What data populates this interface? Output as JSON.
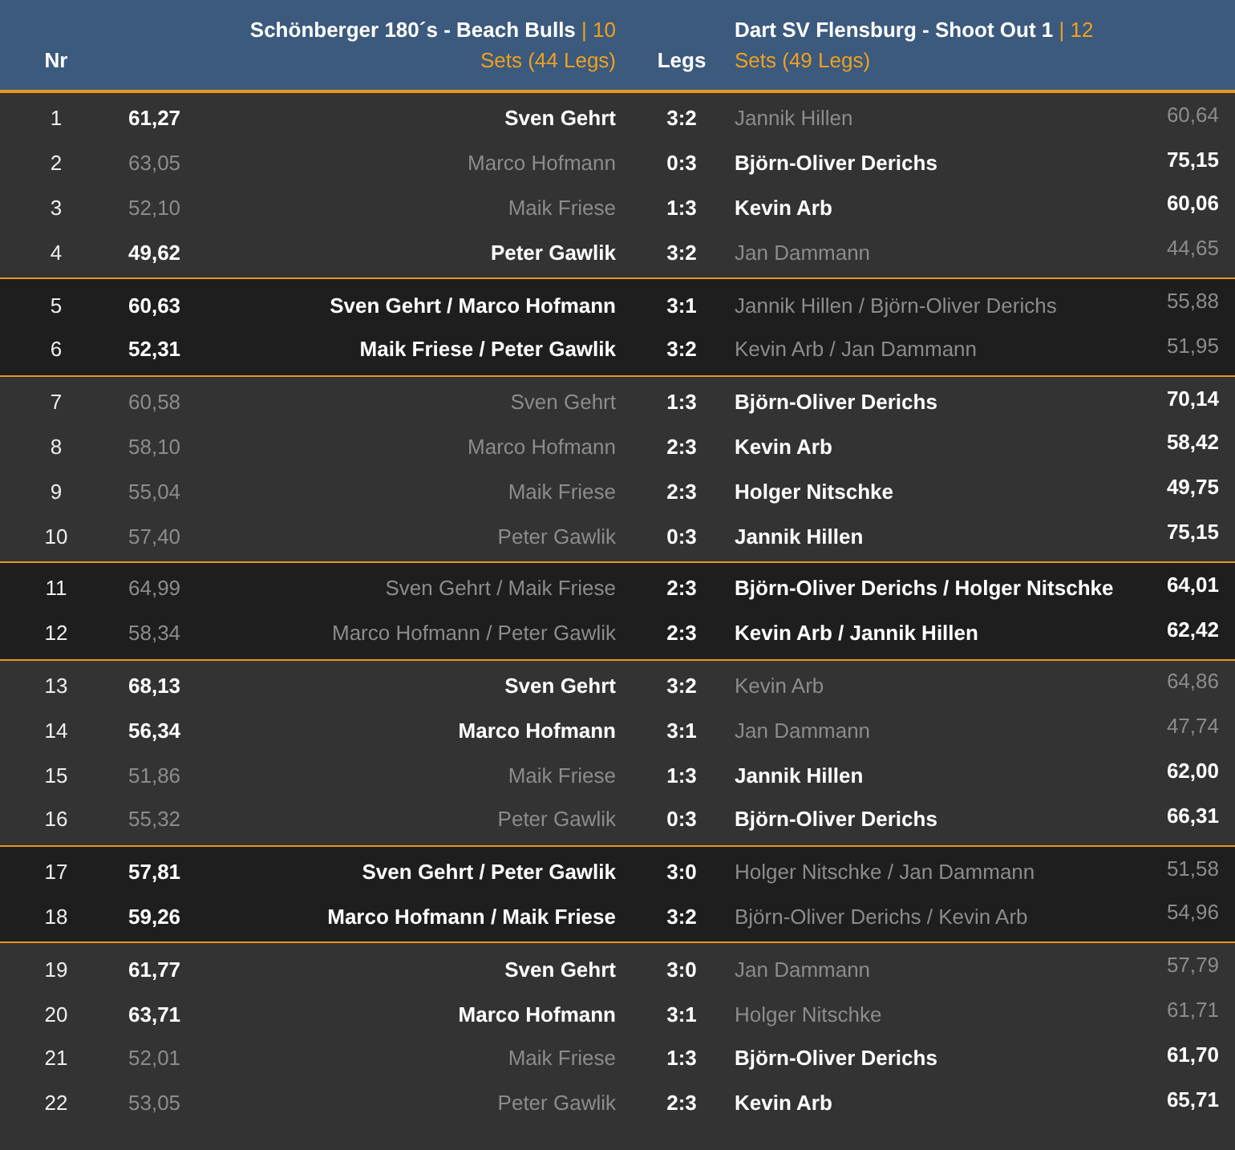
{
  "header": {
    "nr": "Nr",
    "legs": "Legs",
    "home_team": {
      "name": "Schönberger 180´s - Beach Bulls",
      "score": "| 10",
      "summary": "Sets (44 Legs)"
    },
    "away_team": {
      "name": "Dart SV Flensburg - Shoot Out 1",
      "score": "| 12",
      "summary": "Sets (49 Legs)"
    }
  },
  "groups": [
    {
      "kind": "singles",
      "rows": [
        {
          "nr": "1",
          "home_avg": "61,27",
          "home": "Sven Gehrt",
          "legs": "3:2",
          "away": "Jannik Hillen",
          "away_avg": "60,64",
          "home_won": true
        },
        {
          "nr": "2",
          "home_avg": "63,05",
          "home": "Marco Hofmann",
          "legs": "0:3",
          "away": "Björn-Oliver Derichs",
          "away_avg": "75,15",
          "home_won": false
        },
        {
          "nr": "3",
          "home_avg": "52,10",
          "home": "Maik Friese",
          "legs": "1:3",
          "away": "Kevin Arb",
          "away_avg": "60,06",
          "home_won": false
        },
        {
          "nr": "4",
          "home_avg": "49,62",
          "home": "Peter Gawlik",
          "legs": "3:2",
          "away": "Jan Dammann",
          "away_avg": "44,65",
          "home_won": true
        }
      ]
    },
    {
      "kind": "doubles",
      "rows": [
        {
          "nr": "5",
          "home_avg": "60,63",
          "home": "Sven Gehrt / Marco Hofmann",
          "legs": "3:1",
          "away": "Jannik Hillen / Björn-Oliver Derichs",
          "away_avg": "55,88",
          "home_won": true
        },
        {
          "nr": "6",
          "home_avg": "52,31",
          "home": "Maik Friese / Peter Gawlik",
          "legs": "3:2",
          "away": "Kevin Arb / Jan Dammann",
          "away_avg": "51,95",
          "home_won": true
        }
      ]
    },
    {
      "kind": "singles",
      "rows": [
        {
          "nr": "7",
          "home_avg": "60,58",
          "home": "Sven Gehrt",
          "legs": "1:3",
          "away": "Björn-Oliver Derichs",
          "away_avg": "70,14",
          "home_won": false
        },
        {
          "nr": "8",
          "home_avg": "58,10",
          "home": "Marco Hofmann",
          "legs": "2:3",
          "away": "Kevin Arb",
          "away_avg": "58,42",
          "home_won": false
        },
        {
          "nr": "9",
          "home_avg": "55,04",
          "home": "Maik Friese",
          "legs": "2:3",
          "away": "Holger Nitschke",
          "away_avg": "49,75",
          "home_won": false
        },
        {
          "nr": "10",
          "home_avg": "57,40",
          "home": "Peter Gawlik",
          "legs": "0:3",
          "away": "Jannik Hillen",
          "away_avg": "75,15",
          "home_won": false
        }
      ]
    },
    {
      "kind": "doubles",
      "rows": [
        {
          "nr": "11",
          "home_avg": "64,99",
          "home": "Sven Gehrt / Maik Friese",
          "legs": "2:3",
          "away": "Björn-Oliver Derichs / Holger Nitschke",
          "away_avg": "64,01",
          "home_won": false
        },
        {
          "nr": "12",
          "home_avg": "58,34",
          "home": "Marco Hofmann / Peter Gawlik",
          "legs": "2:3",
          "away": "Kevin Arb / Jannik Hillen",
          "away_avg": "62,42",
          "home_won": false
        }
      ]
    },
    {
      "kind": "singles",
      "rows": [
        {
          "nr": "13",
          "home_avg": "68,13",
          "home": "Sven Gehrt",
          "legs": "3:2",
          "away": "Kevin Arb",
          "away_avg": "64,86",
          "home_won": true
        },
        {
          "nr": "14",
          "home_avg": "56,34",
          "home": "Marco Hofmann",
          "legs": "3:1",
          "away": "Jan Dammann",
          "away_avg": "47,74",
          "home_won": true
        },
        {
          "nr": "15",
          "home_avg": "51,86",
          "home": "Maik Friese",
          "legs": "1:3",
          "away": "Jannik Hillen",
          "away_avg": "62,00",
          "home_won": false
        },
        {
          "nr": "16",
          "home_avg": "55,32",
          "home": "Peter Gawlik",
          "legs": "0:3",
          "away": "Björn-Oliver Derichs",
          "away_avg": "66,31",
          "home_won": false
        }
      ]
    },
    {
      "kind": "doubles",
      "rows": [
        {
          "nr": "17",
          "home_avg": "57,81",
          "home": "Sven Gehrt / Peter Gawlik",
          "legs": "3:0",
          "away": "Holger Nitschke / Jan Dammann",
          "away_avg": "51,58",
          "home_won": true
        },
        {
          "nr": "18",
          "home_avg": "59,26",
          "home": "Marco Hofmann / Maik Friese",
          "legs": "3:2",
          "away": "Björn-Oliver Derichs / Kevin Arb",
          "away_avg": "54,96",
          "home_won": true
        }
      ]
    },
    {
      "kind": "singles",
      "rows": [
        {
          "nr": "19",
          "home_avg": "61,77",
          "home": "Sven Gehrt",
          "legs": "3:0",
          "away": "Jan Dammann",
          "away_avg": "57,79",
          "home_won": true
        },
        {
          "nr": "20",
          "home_avg": "63,71",
          "home": "Marco Hofmann",
          "legs": "3:1",
          "away": "Holger Nitschke",
          "away_avg": "61,71",
          "home_won": true
        },
        {
          "nr": "21",
          "home_avg": "52,01",
          "home": "Maik Friese",
          "legs": "1:3",
          "away": "Björn-Oliver Derichs",
          "away_avg": "61,70",
          "home_won": false
        },
        {
          "nr": "22",
          "home_avg": "53,05",
          "home": "Peter Gawlik",
          "legs": "2:3",
          "away": "Kevin Arb",
          "away_avg": "65,71",
          "home_won": false
        }
      ]
    }
  ]
}
